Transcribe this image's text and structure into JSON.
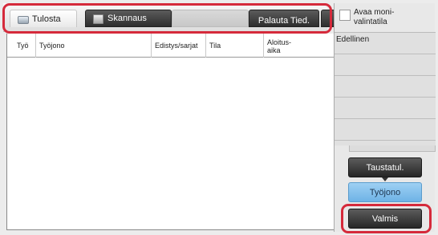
{
  "tabs": {
    "print": "Tulosta",
    "scan": "Skannaus",
    "reset": "Palauta Tied."
  },
  "table": {
    "columns": [
      "Työ",
      "Työjono",
      "Edistys/sarjat",
      "Tila",
      "Aloitus-\naika"
    ]
  },
  "sidebar": {
    "multi_select_label": "Avaa moni-\nvalintatila",
    "rows": [
      "Edellinen",
      "",
      "",
      "",
      ""
    ]
  },
  "buttons": {
    "background": "Taustatul.",
    "job_queue": "Työjono",
    "done": "Valmis"
  },
  "colors": {
    "highlight": "#d52a3b",
    "selected_button": "#8cc6ef"
  },
  "icons": {
    "print": "printer-icon",
    "scan": "scanner-icon"
  }
}
